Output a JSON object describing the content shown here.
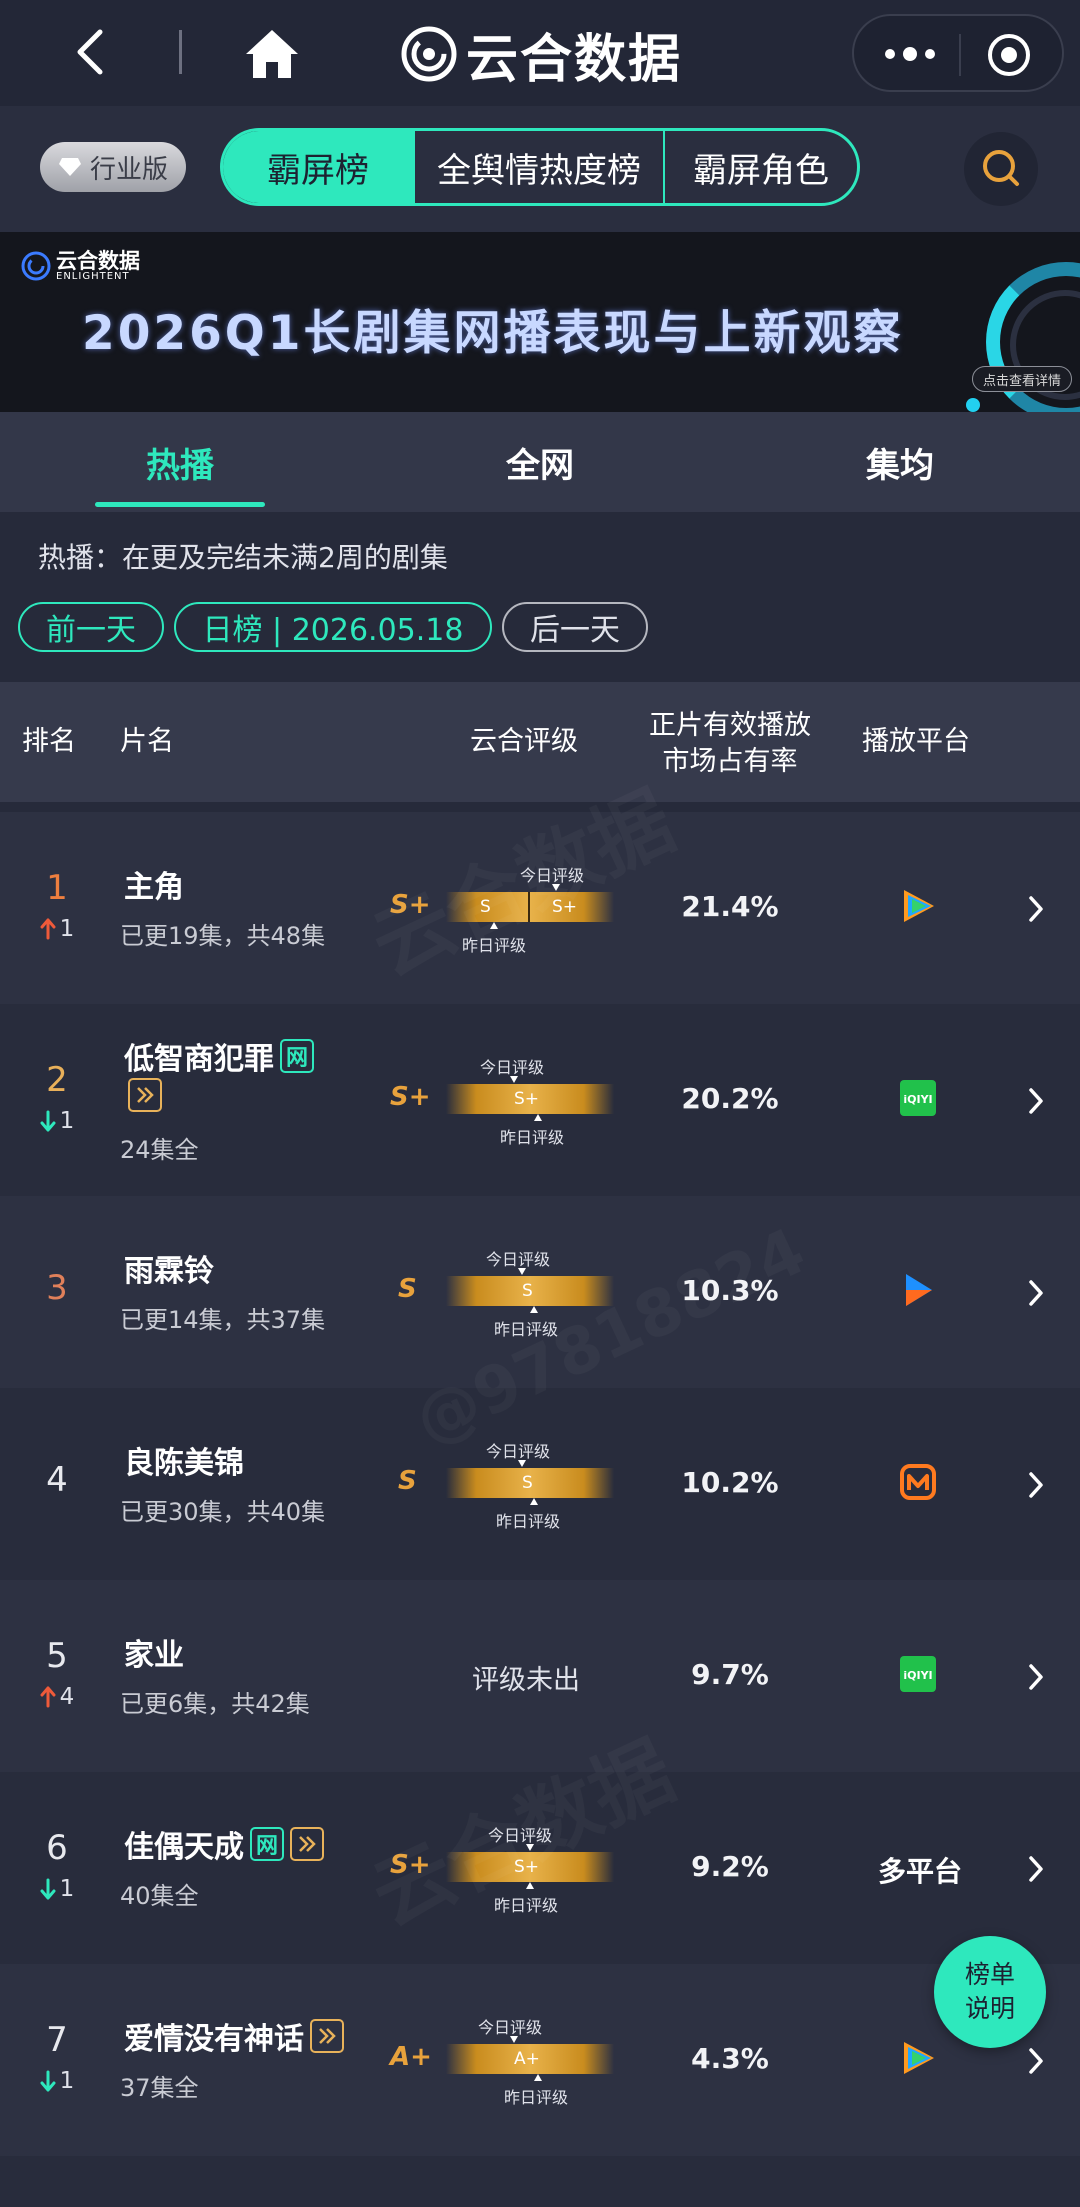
{
  "app": {
    "title": "云合数据"
  },
  "nav": {
    "industry_label": "行业版",
    "tabs": [
      {
        "label": "霸屏榜",
        "active": true
      },
      {
        "label": "全舆情热度榜",
        "active": false
      },
      {
        "label": "霸屏角色",
        "active": false
      }
    ]
  },
  "banner": {
    "logo_cn": "云合数据",
    "logo_en": "ENLIGHTENT",
    "headline": "2026Q1长剧集网播表现与上新观察",
    "detail_button": "点击查看详情"
  },
  "subtabs": [
    {
      "label": "热播",
      "active": true
    },
    {
      "label": "全网",
      "active": false
    },
    {
      "label": "集均",
      "active": false
    }
  ],
  "description": "热播：在更及完结未满2周的剧集",
  "date_nav": {
    "prev": "前一天",
    "current": "日榜 | 2026.05.18",
    "next": "后一天"
  },
  "table": {
    "headers": {
      "rank": "排名",
      "title": "片名",
      "rating": "云合评级",
      "share_line1": "正片有效播放",
      "share_line2": "市场占有率",
      "platform": "播放平台"
    },
    "today_caption": "今日评级",
    "yesterday_caption": "昨日评级",
    "rows": [
      {
        "rank": "1",
        "rank_color": "#ee7f3f",
        "change": "1",
        "change_dir": "up",
        "title": "主角",
        "net_badge": false,
        "play_badge": false,
        "subtitle": "已更19集，共48集",
        "grade": "S+",
        "yesterday_grade": "S",
        "today_grade": "S+",
        "share": "21.4%",
        "platform_icon": "tencent-video-icon"
      },
      {
        "rank": "2",
        "rank_color": "#e8b05a",
        "change": "1",
        "change_dir": "down",
        "title": "低智商犯罪",
        "net_badge": true,
        "net_label": "网",
        "play_badge": true,
        "subtitle": "24集全",
        "grade": "S+",
        "bar_grade": "S+",
        "share": "20.2%",
        "platform_icon": "iqiyi-icon"
      },
      {
        "rank": "3",
        "rank_color": "#e0805a",
        "change": "",
        "change_dir": "none",
        "title": "雨霖铃",
        "net_badge": false,
        "play_badge": false,
        "subtitle": "已更14集，共37集",
        "grade": "S",
        "bar_grade": "S",
        "share": "10.3%",
        "platform_icon": "youku-icon"
      },
      {
        "rank": "4",
        "rank_color": "#e8e9ee",
        "change": "",
        "change_dir": "none",
        "title": "良陈美锦",
        "net_badge": false,
        "play_badge": false,
        "subtitle": "已更30集，共40集",
        "grade": "S",
        "bar_grade": "S",
        "share": "10.2%",
        "platform_icon": "mango-tv-icon"
      },
      {
        "rank": "5",
        "rank_color": "#e8e9ee",
        "change": "4",
        "change_dir": "up",
        "title": "家业",
        "net_badge": false,
        "play_badge": false,
        "subtitle": "已更6集，共42集",
        "no_grade_text": "评级未出",
        "share": "9.7%",
        "platform_icon": "iqiyi-icon"
      },
      {
        "rank": "6",
        "rank_color": "#e8e9ee",
        "change": "1",
        "change_dir": "down",
        "title": "佳偶天成",
        "net_badge": true,
        "net_label": "网",
        "play_badge": true,
        "subtitle": "40集全",
        "grade": "S+",
        "bar_grade": "S+",
        "share": "9.2%",
        "platform_text": "多平台"
      },
      {
        "rank": "7",
        "rank_color": "#e8e9ee",
        "change": "1",
        "change_dir": "down",
        "title": "爱情没有神话",
        "net_badge": false,
        "play_badge": true,
        "subtitle": "37集全",
        "grade": "A+",
        "bar_grade": "A+",
        "share": "4.3%",
        "platform_icon": "tencent-video-icon"
      }
    ]
  },
  "fab": {
    "line1": "榜单",
    "line2": "说明"
  },
  "watermark": {
    "brand": "云合数据",
    "brand_en": "ENLIGHTENT",
    "handle": "@97818824"
  },
  "colors": {
    "accent": "#2ee8bd",
    "background": "#262a3a",
    "gold": "#e8a23c",
    "up": "#ee5a3a",
    "down": "#2ee8bd"
  }
}
